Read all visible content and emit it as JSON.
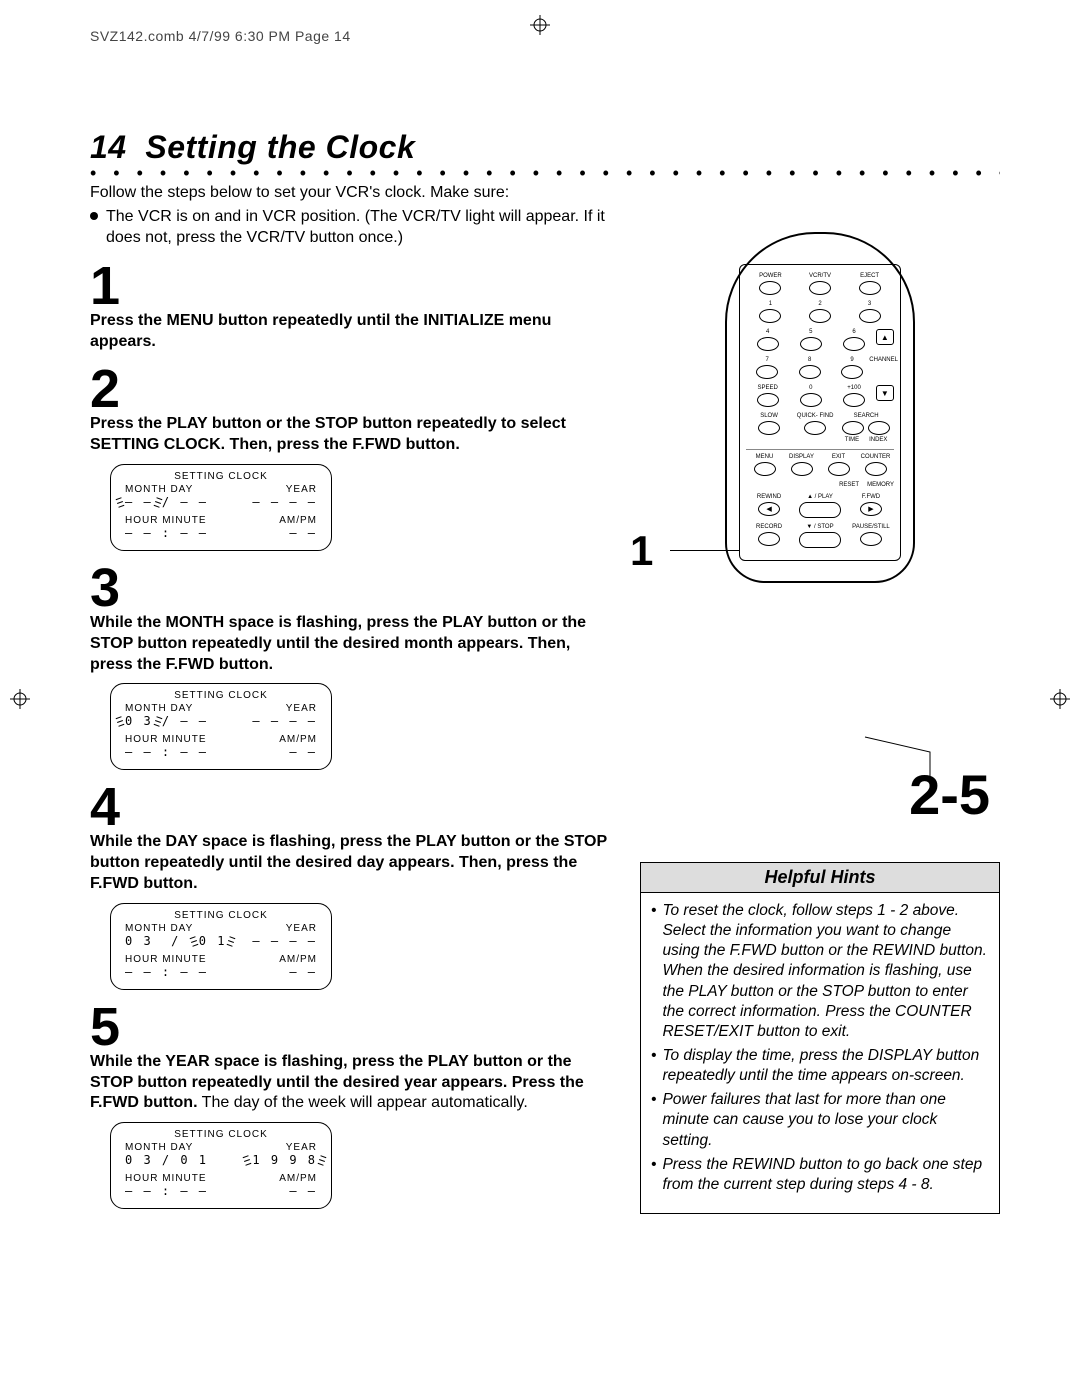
{
  "header": "SVZ142.comb  4/7/99  6:30 PM  Page 14",
  "page_number": "14",
  "page_title": "Setting the Clock",
  "intro_line": "Follow the steps below to set your VCR's clock.  Make sure:",
  "intro_bullet": "The VCR is on and in VCR position. (The VCR/TV light will appear. If it does not, press the VCR/TV button once.)",
  "steps": {
    "s1": {
      "num": "1",
      "text": "Press the MENU button repeatedly until the INITIALIZE menu appears."
    },
    "s2": {
      "num": "2",
      "text": "Press the PLAY button or the STOP button repeatedly to select SETTING CLOCK. Then, press the F.FWD button."
    },
    "s3": {
      "num": "3",
      "text": "While the MONTH space is flashing, press the PLAY button or the STOP button repeatedly until the desired month appears. Then, press the F.FWD button."
    },
    "s4": {
      "num": "4",
      "text": "While the DAY space is flashing, press the PLAY button or the STOP button repeatedly until the desired day appears. Then, press the F.FWD button."
    },
    "s5": {
      "num": "5",
      "text_bold": "While the YEAR space is flashing, press the PLAY button or the STOP button repeatedly until the desired year appears. Press the F.FWD button.",
      "text_plain": " The day of the week will appear automatically."
    }
  },
  "osd": {
    "title": "SETTING CLOCK",
    "row1_left": "MONTH DAY",
    "row1_right": "YEAR",
    "row2_left": "HOUR MINUTE",
    "row2_right": "AM/PM",
    "dashes_date": "– – / – –",
    "dashes_year": "– – – –",
    "dashes_time": "– – : – –",
    "dashes_ampm": "– –",
    "screen3_date": "0 3 / – –",
    "screen4_date": "0 3  /  0 1",
    "screen5_date": "0 3 /  0 1",
    "screen5_year": "1 9 9 8"
  },
  "remote": {
    "labels": {
      "power": "POWER",
      "vcrtv": "VCR/TV",
      "eject": "EJECT",
      "channel": "CHANNEL",
      "speed": "SPEED",
      "plus100": "+100",
      "slow": "SLOW",
      "quickfind": "QUICK-\nFIND",
      "search": "SEARCH",
      "time": "TIME",
      "index": "INDEX",
      "menu": "MENU",
      "display": "DISPLAY",
      "exit": "EXIT",
      "counter": "COUNTER",
      "reset": "RESET",
      "memory": "MEMORY",
      "rewind": "REWIND",
      "play": "▲ / PLAY",
      "ffwd": "F.FWD",
      "record": "RECORD",
      "stop": "▼ / STOP",
      "pause": "PAUSE/STILL"
    },
    "digits": [
      "1",
      "2",
      "3",
      "4",
      "5",
      "6",
      "7",
      "8",
      "9",
      "0"
    ]
  },
  "ref_left": "1",
  "ref_right": "2-5",
  "hints": {
    "title": "Helpful Hints",
    "items": [
      "To reset the clock, follow steps 1 - 2 above. Select the information you want to change using the F.FWD button or the REWIND button. When the desired information is flashing, use the PLAY button or the STOP button to enter the correct information. Press the COUNTER RESET/EXIT button to exit.",
      "To display the time, press the DISPLAY button repeatedly until the time appears on-screen.",
      "Power failures that last for more than one minute can cause you to lose your clock setting.",
      "Press the REWIND button to go back one step from the current step during steps 4 - 8."
    ]
  }
}
